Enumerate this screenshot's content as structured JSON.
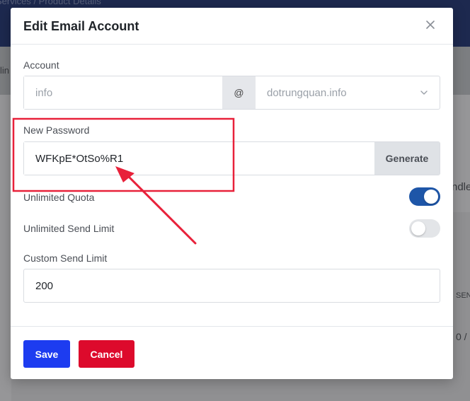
{
  "background": {
    "breadcrumb": "Services  /  Product Details",
    "fragments": [
      "lin",
      "ndle",
      "SEN",
      "0 /"
    ]
  },
  "modal": {
    "title": "Edit Email Account",
    "close_icon": "close-icon"
  },
  "account": {
    "label": "Account",
    "username_value": "info",
    "at_symbol": "@",
    "domain_value": "dotrungquan.info",
    "domain_icon": "chevron-down-icon"
  },
  "password": {
    "label": "New Password",
    "value": "WFKpE*OtSo%R1",
    "generate_label": "Generate"
  },
  "quota": {
    "label": "Unlimited Quota",
    "enabled": true
  },
  "send_limit": {
    "label": "Unlimited Send Limit",
    "enabled": false
  },
  "custom_limit": {
    "label": "Custom Send Limit",
    "value": "200"
  },
  "footer": {
    "save_label": "Save",
    "cancel_label": "Cancel"
  },
  "colors": {
    "primary": "#1d3cf0",
    "danger": "#dd0a2c",
    "toggle_on": "#1e56a8",
    "annotation": "#e8213a"
  }
}
